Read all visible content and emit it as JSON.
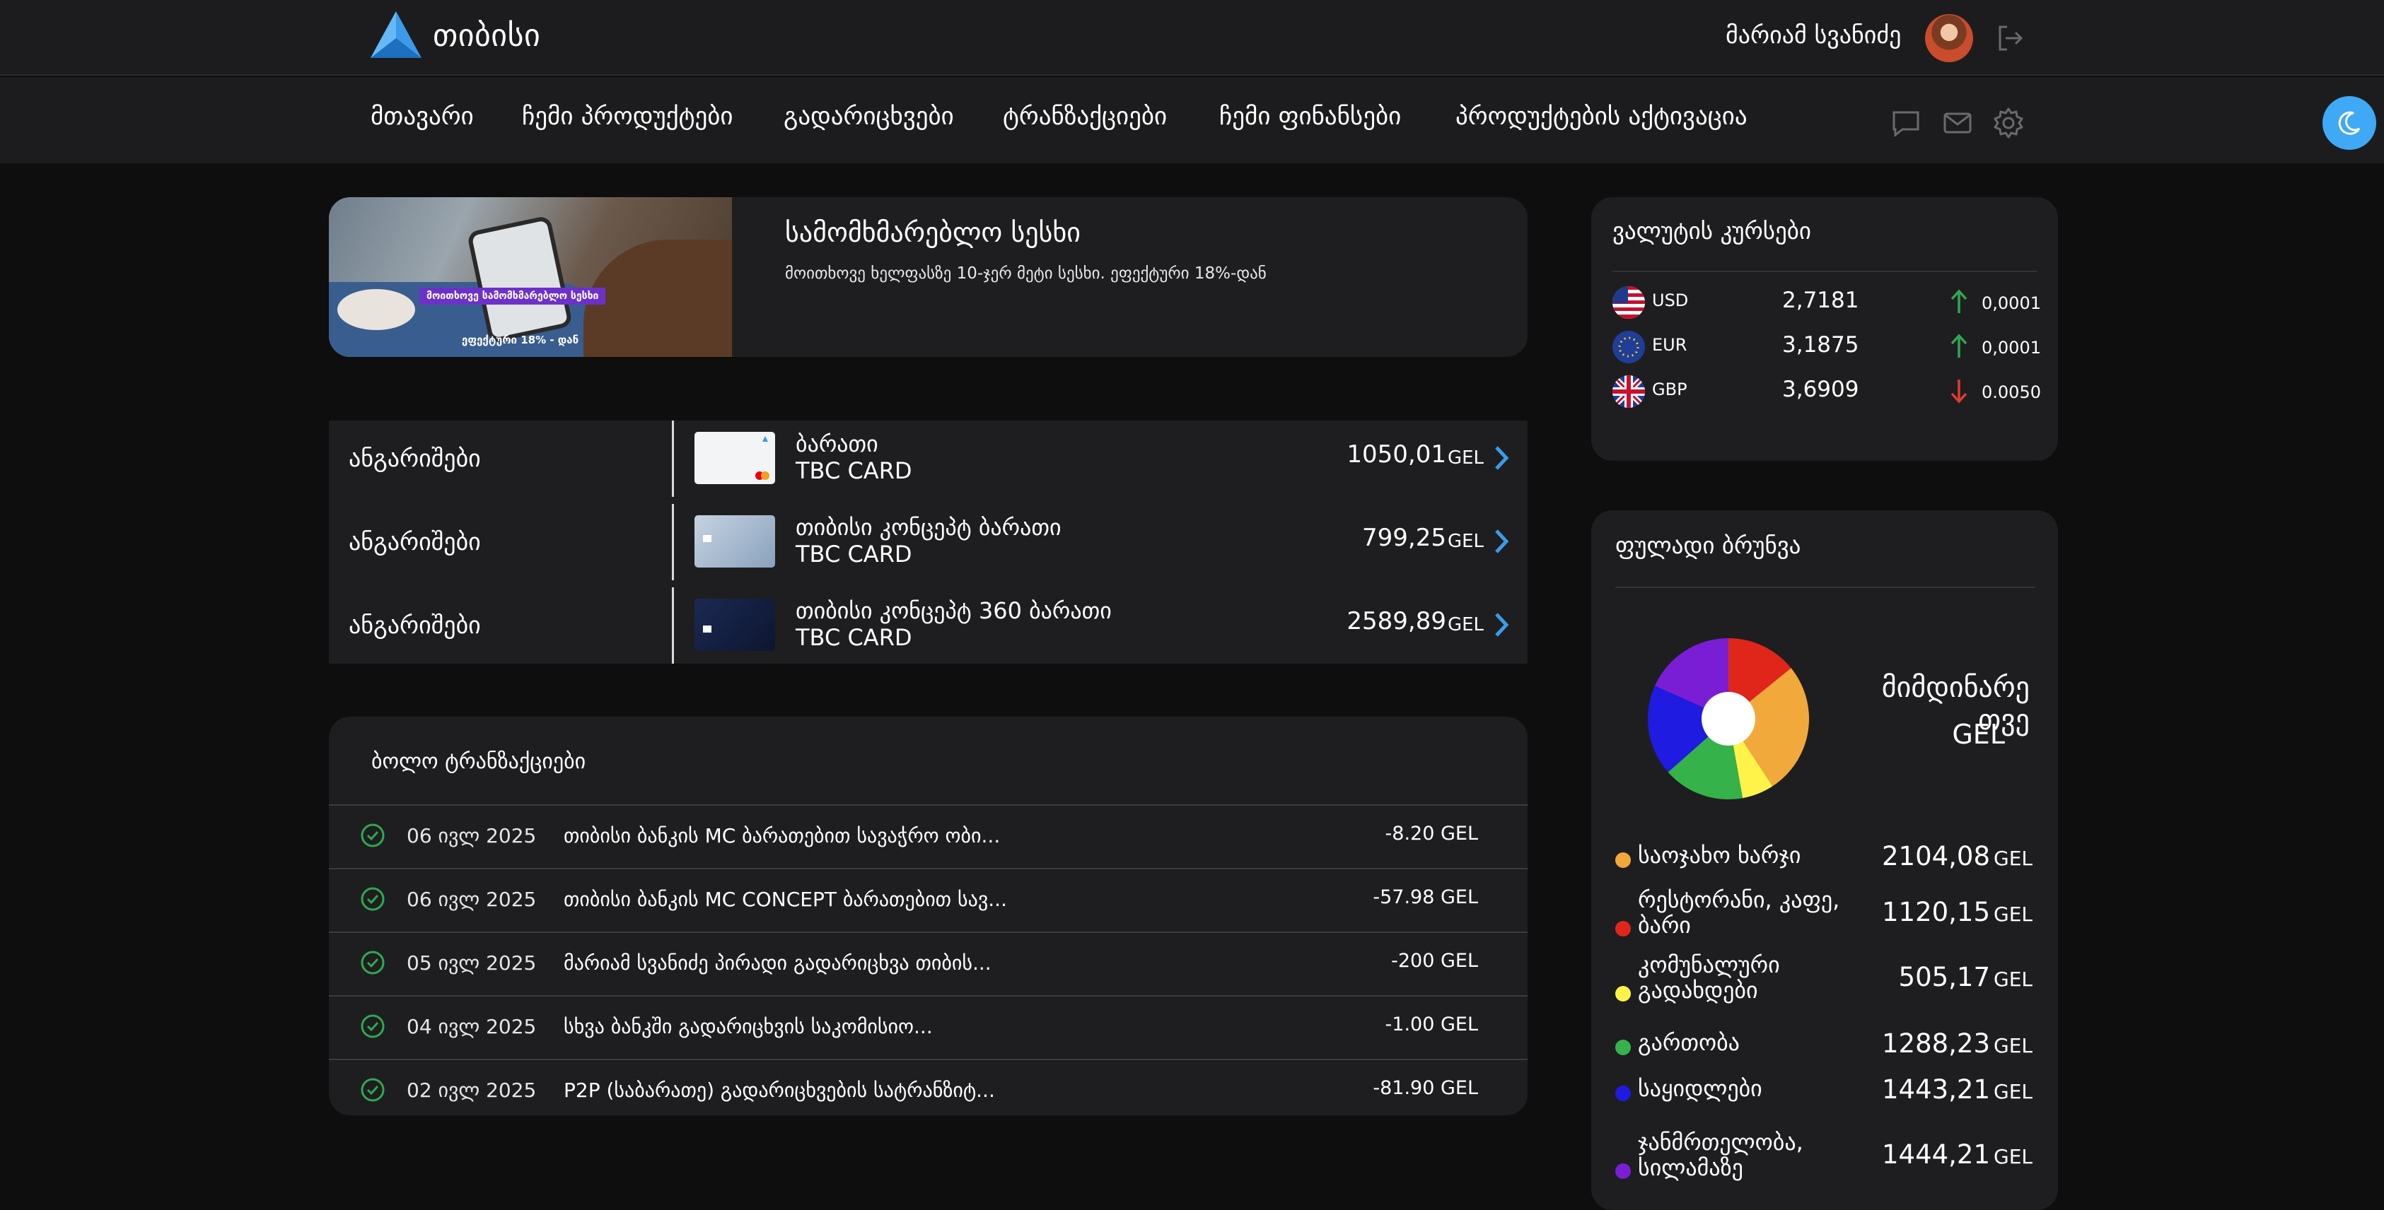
{
  "header": {
    "logo_text": "თიბისი",
    "user_name": "მარიამ სვანიძე"
  },
  "nav": {
    "items": [
      "მთავარი",
      "ჩემი პროდუქტები",
      "გადარიცხვები",
      "ტრანზაქციები",
      "ჩემი ფინანსები",
      "პროდუქტების აქტივაცია"
    ],
    "icons": [
      "chat-icon",
      "mail-icon",
      "gear-icon"
    ],
    "theme_icon": "moon-icon"
  },
  "promo": {
    "title": "სამომხმარებლო სესხი",
    "subtitle": "მოითხოვე ხელფასზე 10-ჯერ მეტი სესხი. ეფექტური 18%-დან",
    "image_tag1": "მოითხოვე სამომხმარებლო სესხი",
    "image_tag2": "ეფექტური 18% - დან"
  },
  "accounts": [
    {
      "label": "ანგარიშები",
      "card_name": "ბარათი",
      "card_type": "TBC CARD",
      "amount": "1050,01",
      "currency": "GEL"
    },
    {
      "label": "ანგარიშები",
      "card_name": "თიბისი კონცეპტ ბარათი",
      "card_type": "TBC CARD",
      "amount": "799,25",
      "currency": "GEL"
    },
    {
      "label": "ანგარიშები",
      "card_name": "თიბისი კონცეპტ 360 ბარათი",
      "card_type": "TBC CARD",
      "amount": "2589,89",
      "currency": "GEL"
    }
  ],
  "transactions": {
    "title": "ბოლო ტრანზაქციები",
    "rows": [
      {
        "date": "06 ივლ 2025",
        "desc": "თიბისი ბანკის MC ბარათებით სავაჭრო ობი...",
        "amount": "-8.20 GEL"
      },
      {
        "date": "06 ივლ 2025",
        "desc": "თიბისი ბანკის MC CONCEPT ბარათებით სავ...",
        "amount": "-57.98 GEL"
      },
      {
        "date": "05 ივლ 2025",
        "desc": "მარიამ სვანიძე პირადი გადარიცხვა თიბის...",
        "amount": "-200 GEL"
      },
      {
        "date": "04 ივლ 2025",
        "desc": "სხვა ბანკში გადარიცხვის საკომისიო...",
        "amount": "-1.00 GEL"
      },
      {
        "date": "02 ივლ 2025",
        "desc": "P2P (საბარათე) გადარიცხვების სატრანზიტ...",
        "amount": "-81.90 GEL"
      }
    ]
  },
  "fx": {
    "title": "ვალუტის კურსები",
    "rows": [
      {
        "code": "USD",
        "rate": "2,7181",
        "change": "0,0001",
        "direction": "up"
      },
      {
        "code": "EUR",
        "rate": "3,1875",
        "change": "0,0001",
        "direction": "up"
      },
      {
        "code": "GBP",
        "rate": "3,6909",
        "change": "0.0050",
        "direction": "down"
      }
    ],
    "colors": {
      "up": "#2fa84f",
      "down": "#e23b30"
    }
  },
  "cashflow": {
    "title": "ფულადი ბრუნვა",
    "period": "მიმდინარე თვე",
    "currency": "GEL",
    "items": [
      {
        "label": "საოჯახო ხარჯი",
        "amount": "2104,08",
        "unit": "GEL",
        "color": "#f2a93b"
      },
      {
        "label": "რესტორანი, კაფე, ბარი",
        "amount": "1120,15",
        "unit": "GEL",
        "color": "#e0261b"
      },
      {
        "label": "კომუნალური გადახდები",
        "amount": "505,17",
        "unit": "GEL",
        "color": "#fff34a"
      },
      {
        "label": "გართობა",
        "amount": "1288,23",
        "unit": "GEL",
        "color": "#35b24a"
      },
      {
        "label": "საყიდლები",
        "amount": "1443,21",
        "unit": "GEL",
        "color": "#1f1be0"
      },
      {
        "label": "ჯანმრთელობა, სილამაზე",
        "amount": "1444,21",
        "unit": "GEL",
        "color": "#7a1ed6"
      }
    ]
  },
  "chart_data": {
    "type": "pie",
    "categories": [
      "საოჯახო ხარჯი",
      "რესტორანი, კაფე, ბარი",
      "კომუნალური გადახდები",
      "გართობა",
      "საყიდლები",
      "ჯანმრთელობა, სილამაზე"
    ],
    "values": [
      2104.08,
      1120.15,
      505.17,
      1288.23,
      1443.21,
      1444.21
    ],
    "colors": [
      "#f2a93b",
      "#e0261b",
      "#fff34a",
      "#35b24a",
      "#1f1be0",
      "#7a1ed6"
    ]
  }
}
